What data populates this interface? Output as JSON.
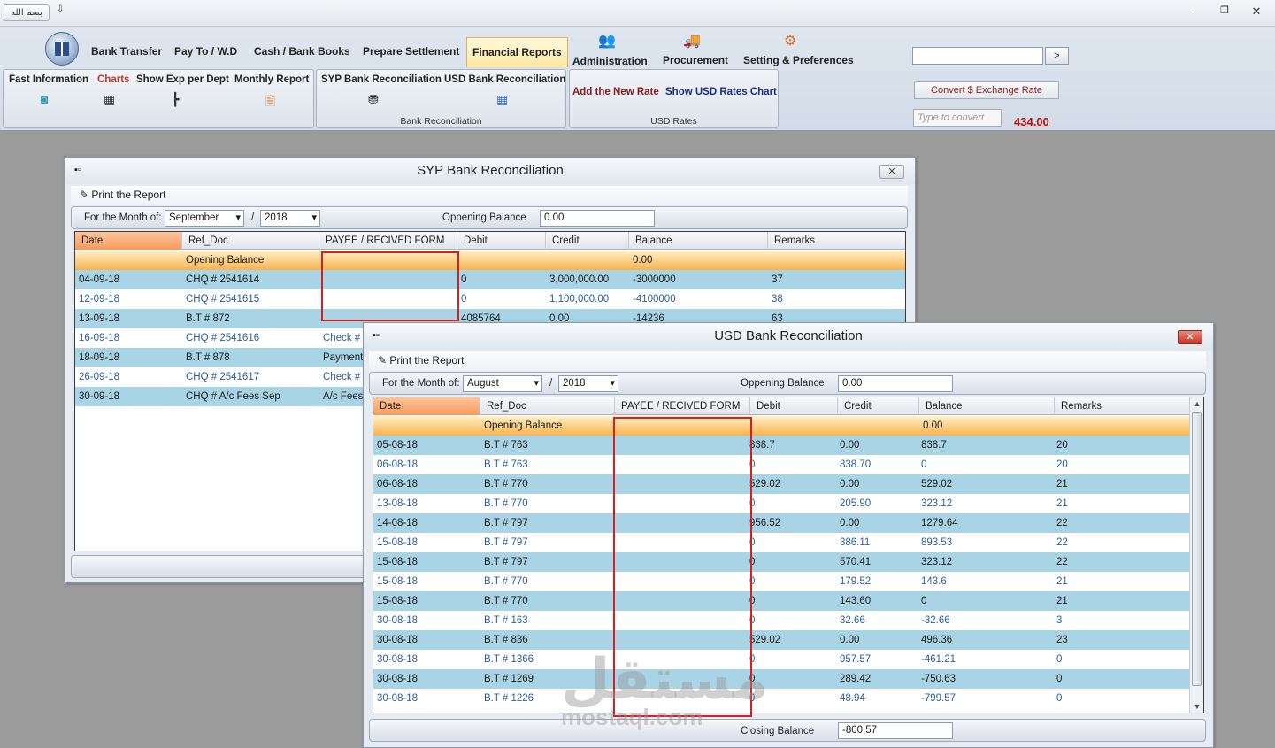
{
  "app": {
    "qat_label": "بسم الله",
    "qat_dropdown": "⇩"
  },
  "window_controls": {
    "minimize": "–",
    "restore": "❐",
    "close": "✕"
  },
  "ribbon": {
    "tabs": [
      {
        "label": "Bank Transfer"
      },
      {
        "label": "Pay To / W.D"
      },
      {
        "label": "Cash / Bank Books"
      },
      {
        "label": "Prepare Settlement"
      },
      {
        "label": "Financial Reports"
      },
      {
        "label": "Administration"
      },
      {
        "label": "Procurement"
      },
      {
        "label": "Setting & Preferences"
      }
    ],
    "reports_group": {
      "fast_info": "Fast Information",
      "charts": "Charts",
      "show_exp": "Show Exp per Dept",
      "monthly": "Monthly Report"
    },
    "bank_group": {
      "syp": "SYP Bank Reconciliation",
      "usd": "USD Bank Reconciliation",
      "label": "Bank Reconciliation"
    },
    "rates_group": {
      "add_rate": "Add the New Rate",
      "show_chart": "Show USD Rates Chart",
      "label": "USD Rates"
    },
    "search_go": ">",
    "convert_button": "Convert $ Exchange Rate",
    "convert_placeholder": "Type to convert",
    "rate_value": "434.00"
  },
  "columns": [
    "Date",
    "Ref_Doc",
    "PAYEE / RECIVED FORM",
    "Debit",
    "Credit",
    "Balance",
    "Remarks"
  ],
  "syp": {
    "title": "SYP Bank Reconciliation",
    "print": "Print the Report",
    "month_label": "For the Month of:",
    "month": "September",
    "sep": "/",
    "year": "2018",
    "opening_label": "Oppening Balance",
    "opening_value": "0.00",
    "opening_row": {
      "ref": "Opening Balance",
      "balance": "0.00"
    },
    "rows": [
      {
        "date": "04-09-18",
        "ref": "CHQ # 2541614",
        "payee": "",
        "debit": "0",
        "credit": "3,000,000.00",
        "balance": "-3000000",
        "remarks": "37"
      },
      {
        "date": "12-09-18",
        "ref": "CHQ # 2541615",
        "payee": "",
        "debit": "0",
        "credit": "1,100,000.00",
        "balance": "-4100000",
        "remarks": "38"
      },
      {
        "date": "13-09-18",
        "ref": "B.T # 872",
        "payee": "",
        "debit": "4085764",
        "credit": "0.00",
        "balance": "-14236",
        "remarks": "63"
      },
      {
        "date": "16-09-18",
        "ref": "CHQ # 2541616",
        "payee": "Check # 2",
        "debit": "",
        "credit": "",
        "balance": "",
        "remarks": ""
      },
      {
        "date": "18-09-18",
        "ref": "B.T # 878",
        "payee": "Payment",
        "debit": "",
        "credit": "",
        "balance": "",
        "remarks": ""
      },
      {
        "date": "26-09-18",
        "ref": "CHQ # 2541617",
        "payee": "Check # 2",
        "debit": "",
        "credit": "",
        "balance": "",
        "remarks": ""
      },
      {
        "date": "30-09-18",
        "ref": "CHQ # A/c Fees Sep",
        "payee": "A/c Fees S",
        "debit": "",
        "credit": "",
        "balance": "",
        "remarks": ""
      }
    ]
  },
  "usd": {
    "title": "USD Bank Reconciliation",
    "print": "Print the Report",
    "month_label": "For the Month of:",
    "month": "August",
    "sep": "/",
    "year": "2018",
    "opening_label": "Oppening Balance",
    "opening_value": "0.00",
    "opening_row": {
      "ref": "Opening Balance",
      "balance": "0.00"
    },
    "closing_label": "Closing Balance",
    "closing_value": "-800.57",
    "rows": [
      {
        "date": "05-08-18",
        "ref": "B.T # 763",
        "debit": "838.7",
        "credit": "0.00",
        "balance": "838.7",
        "remarks": "20"
      },
      {
        "date": "06-08-18",
        "ref": "B.T # 763",
        "debit": "0",
        "credit": "838.70",
        "balance": "0",
        "remarks": "20"
      },
      {
        "date": "06-08-18",
        "ref": "B.T # 770",
        "debit": "529.02",
        "credit": "0.00",
        "balance": "529.02",
        "remarks": "21"
      },
      {
        "date": "13-08-18",
        "ref": "B.T # 770",
        "debit": "0",
        "credit": "205.90",
        "balance": "323.12",
        "remarks": "21"
      },
      {
        "date": "14-08-18",
        "ref": "B.T # 797",
        "debit": "956.52",
        "credit": "0.00",
        "balance": "1279.64",
        "remarks": "22"
      },
      {
        "date": "15-08-18",
        "ref": "B.T # 797",
        "debit": "0",
        "credit": "386.11",
        "balance": "893.53",
        "remarks": "22"
      },
      {
        "date": "15-08-18",
        "ref": "B.T # 797",
        "debit": "0",
        "credit": "570.41",
        "balance": "323.12",
        "remarks": "22"
      },
      {
        "date": "15-08-18",
        "ref": "B.T # 770",
        "debit": "0",
        "credit": "179.52",
        "balance": "143.6",
        "remarks": "21"
      },
      {
        "date": "15-08-18",
        "ref": "B.T # 770",
        "debit": "0",
        "credit": "143.60",
        "balance": "0",
        "remarks": "21"
      },
      {
        "date": "30-08-18",
        "ref": "B.T # 163",
        "debit": "0",
        "credit": "32.66",
        "balance": "-32.66",
        "remarks": "3"
      },
      {
        "date": "30-08-18",
        "ref": "B.T # 836",
        "debit": "529.02",
        "credit": "0.00",
        "balance": "496.36",
        "remarks": "23"
      },
      {
        "date": "30-08-18",
        "ref": "B.T # 1366",
        "debit": "0",
        "credit": "957.57",
        "balance": "-461.21",
        "remarks": "0"
      },
      {
        "date": "30-08-18",
        "ref": "B.T # 1269",
        "debit": "0",
        "credit": "289.42",
        "balance": "-750.63",
        "remarks": "0"
      },
      {
        "date": "30-08-18",
        "ref": "B.T # 1226",
        "debit": "0",
        "credit": "48.94",
        "balance": "-799.57",
        "remarks": "0"
      }
    ]
  },
  "watermark": {
    "arabic": "مستقل",
    "latin": "mostaql.com"
  }
}
